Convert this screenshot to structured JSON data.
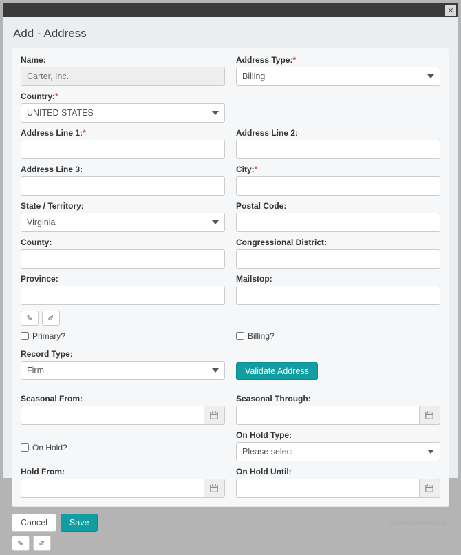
{
  "window": {
    "close_title": "Close"
  },
  "page": {
    "title": "Add - Address"
  },
  "labels": {
    "name": "Name:",
    "address_type": "Address Type:",
    "country": "Country:",
    "addr1": "Address Line 1:",
    "addr2": "Address Line 2:",
    "addr3": "Address Line 3:",
    "city": "City:",
    "state": "State / Territory:",
    "postal": "Postal Code:",
    "county": "County:",
    "congressional": "Congressional District:",
    "province": "Province:",
    "mailstop": "Mailstop:",
    "primary": "Primary?",
    "billing": "Billing?",
    "record_type": "Record Type:",
    "validate": "Validate Address",
    "seasonal_from": "Seasonal From:",
    "seasonal_through": "Seasonal Through:",
    "on_hold": "On Hold?",
    "on_hold_type": "On Hold Type:",
    "hold_from": "Hold From:",
    "on_hold_until": "On Hold Until:"
  },
  "values": {
    "name": "Carter, Inc.",
    "address_type": "Billing",
    "country": "UNITED STATES",
    "addr1": "",
    "addr2": "",
    "addr3": "",
    "city": "",
    "state": "Virginia",
    "postal": "",
    "county": "",
    "congressional": "",
    "province": "",
    "mailstop": "",
    "record_type": "Firm",
    "on_hold_type": "Please select",
    "seasonal_from": "",
    "seasonal_through": "",
    "hold_from": "",
    "on_hold_until": ""
  },
  "footer": {
    "cancel": "Cancel",
    "save": "Save",
    "record_info": "record information"
  }
}
